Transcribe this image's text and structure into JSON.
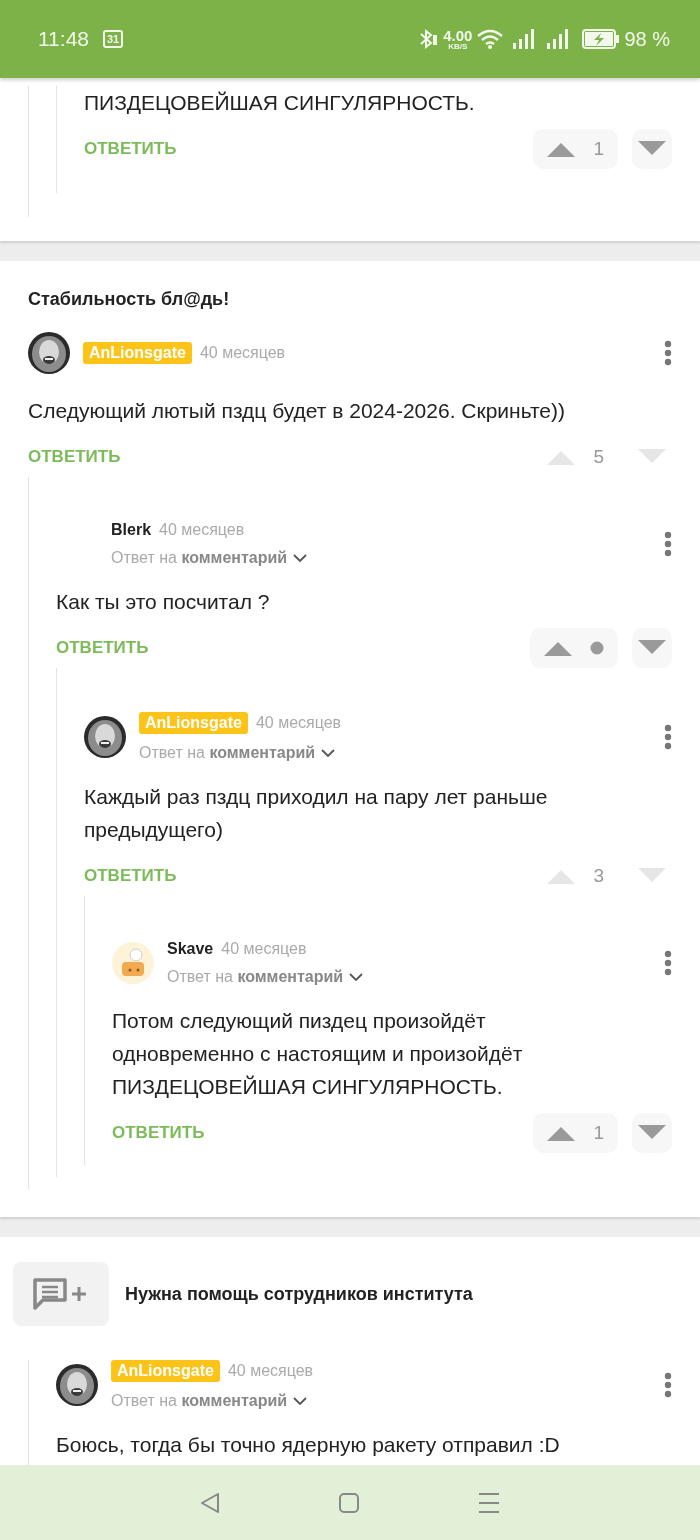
{
  "status_bar": {
    "time": "11:48",
    "calendar_day": "31",
    "net_speed": "4.00",
    "net_unit": "KB/S",
    "battery": "98 %"
  },
  "sections": [
    {
      "comments": [
        {
          "children": [
            {
              "children": [
                {
                  "text": "ПИЗДЕЦОВЕЙШАЯ СИНГУЛЯРНОСТЬ.",
                  "reply_label": "ОТВЕТИТЬ",
                  "rating": "1",
                  "votable": true
                }
              ]
            }
          ]
        }
      ]
    },
    {
      "title": "Стабильность бл@дь!",
      "comments": [
        {
          "author": "AnLionsgate",
          "highlight": true,
          "time": "40 месяцев",
          "text": "Следующий лютый пздц будет в 2024-2026. Скриньте))",
          "reply_label": "ОТВЕТИТЬ",
          "rating": "5",
          "votable": false,
          "children": [
            {
              "author": "Blerk",
              "highlight": false,
              "time": "40 месяцев",
              "reply_to": "Ответ на **комментарий**",
              "text": "Как ты это посчитал ?",
              "reply_label": "ОТВЕТИТЬ",
              "rating_hidden": true,
              "votable": true,
              "children": [
                {
                  "author": "AnLionsgate",
                  "highlight": true,
                  "time": "40 месяцев",
                  "reply_to": "Ответ на **комментарий**",
                  "text": "Каждый раз пздц приходил на пару лет раньше предыдущего)",
                  "reply_label": "ОТВЕТИТЬ",
                  "rating": "3",
                  "votable": false,
                  "children": [
                    {
                      "author": "Skave",
                      "highlight": false,
                      "avatar": {
                        "kind": "drawing"
                      },
                      "time": "40 месяцев",
                      "reply_to": "Ответ на **комментарий**",
                      "text": "Потом следующий пиздец произойдёт одновременно с настоящим и произойдёт ПИЗДЕЦОВЕЙШАЯ СИНГУЛЯРНОСТЬ.",
                      "reply_label": "ОТВЕТИТЬ",
                      "rating": "1",
                      "votable": true
                    }
                  ]
                }
              ]
            }
          ]
        }
      ]
    },
    {
      "title": "Нужна помощь сотрудников института",
      "add_comment_button": true,
      "comments": [
        {
          "children": [
            {
              "author": "AnLionsgate",
              "highlight": true,
              "time": "40 месяцев",
              "reply_to": "Ответ на **комментарий**",
              "text": "Боюсь, тогда бы точно ядерную ракету отправил :D"
            }
          ]
        }
      ]
    }
  ]
}
